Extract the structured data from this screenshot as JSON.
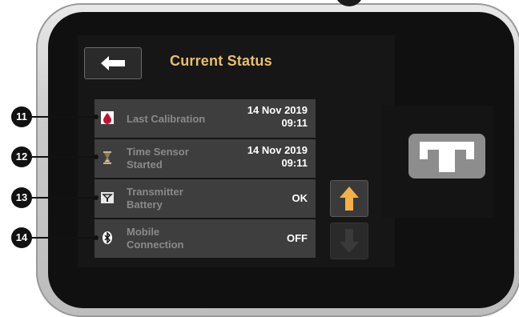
{
  "header": {
    "back_icon": "arrow-left-icon",
    "title": "Current Status"
  },
  "rows": [
    {
      "icon": "blood-drop-icon",
      "label_line1": "Last Calibration",
      "label_line2": "",
      "value_line1": "14 Nov 2019",
      "value_line2": "09:11"
    },
    {
      "icon": "hourglass-icon",
      "label_line1": "Time Sensor",
      "label_line2": "Started",
      "value_line1": "14 Nov 2019",
      "value_line2": "09:11"
    },
    {
      "icon": "transmitter-icon",
      "label_line1": "Transmitter",
      "label_line2": "Battery",
      "value_line1": "OK",
      "value_line2": ""
    },
    {
      "icon": "bluetooth-icon",
      "label_line1": "Mobile",
      "label_line2": "Connection",
      "value_line1": "OFF",
      "value_line2": ""
    }
  ],
  "scroll": {
    "up_icon": "arrow-up-icon",
    "down_icon": "arrow-down-icon"
  },
  "home_button": {
    "icon": "t-logo-icon"
  },
  "callouts": [
    "11",
    "12",
    "13",
    "14"
  ],
  "colors": {
    "title": "#e8c06a",
    "row_bg": "#3e3e3e",
    "up_arrow": "#f2b04a",
    "home_button": "#8d8d8d"
  }
}
